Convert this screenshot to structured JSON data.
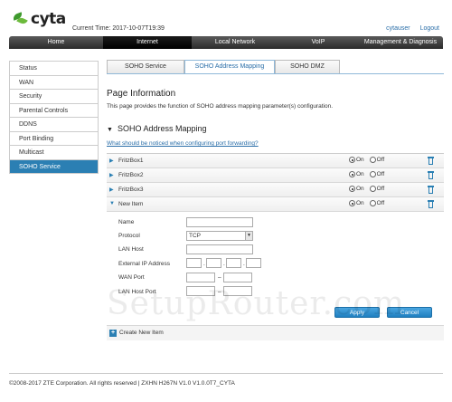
{
  "header": {
    "brand": "cyta",
    "current_time": "Current Time: 2017-10-07T19:39",
    "user": "cytauser",
    "logout": "Logout"
  },
  "nav": {
    "items": [
      {
        "label": "Home"
      },
      {
        "label": "Internet"
      },
      {
        "label": "Local Network"
      },
      {
        "label": "VoIP"
      },
      {
        "label": "Management & Diagnosis"
      }
    ]
  },
  "sidebar": {
    "items": [
      {
        "label": "Status"
      },
      {
        "label": "WAN"
      },
      {
        "label": "Security"
      },
      {
        "label": "Parental Controls"
      },
      {
        "label": "DDNS"
      },
      {
        "label": "Port Binding"
      },
      {
        "label": "Multicast"
      },
      {
        "label": "SOHO Service"
      }
    ]
  },
  "tabs": [
    {
      "label": "SOHO Service"
    },
    {
      "label": "SOHO Address Mapping"
    },
    {
      "label": "SOHO DMZ"
    }
  ],
  "main": {
    "title": "Page Information",
    "description": "This page provides the function of SOHO address mapping parameter(s) configuration.",
    "section_title": "SOHO Address Mapping",
    "notice_link": "What should be noticed when configuring port forwarding?"
  },
  "rows": [
    {
      "name": "FritzBox1",
      "on": "On",
      "off": "Off"
    },
    {
      "name": "FritzBox2",
      "on": "On",
      "off": "Off"
    },
    {
      "name": "FritzBox3",
      "on": "On",
      "off": "Off"
    },
    {
      "name": "New Item",
      "on": "On",
      "off": "Off"
    }
  ],
  "form": {
    "name_label": "Name",
    "protocol_label": "Protocol",
    "protocol_value": "TCP",
    "lan_host_label": "LAN Host",
    "external_ip_label": "External IP Address",
    "wan_port_label": "WAN Port",
    "lan_host_port_label": "LAN Host Port",
    "ip_sep": ".",
    "range_sep": "–",
    "apply": "Apply",
    "cancel": "Cancel"
  },
  "create_new_item": "Create New Item",
  "watermark": "SetupRouter.com",
  "footer": "©2008-2017 ZTE Corporation. All rights reserved  |  ZXHN H267N V1.0 V1.0.0T7_CYTA",
  "colors": {
    "accent": "#2b7fb3",
    "nav_bg": "#2b2b2b",
    "button": "#1f7fc0"
  }
}
